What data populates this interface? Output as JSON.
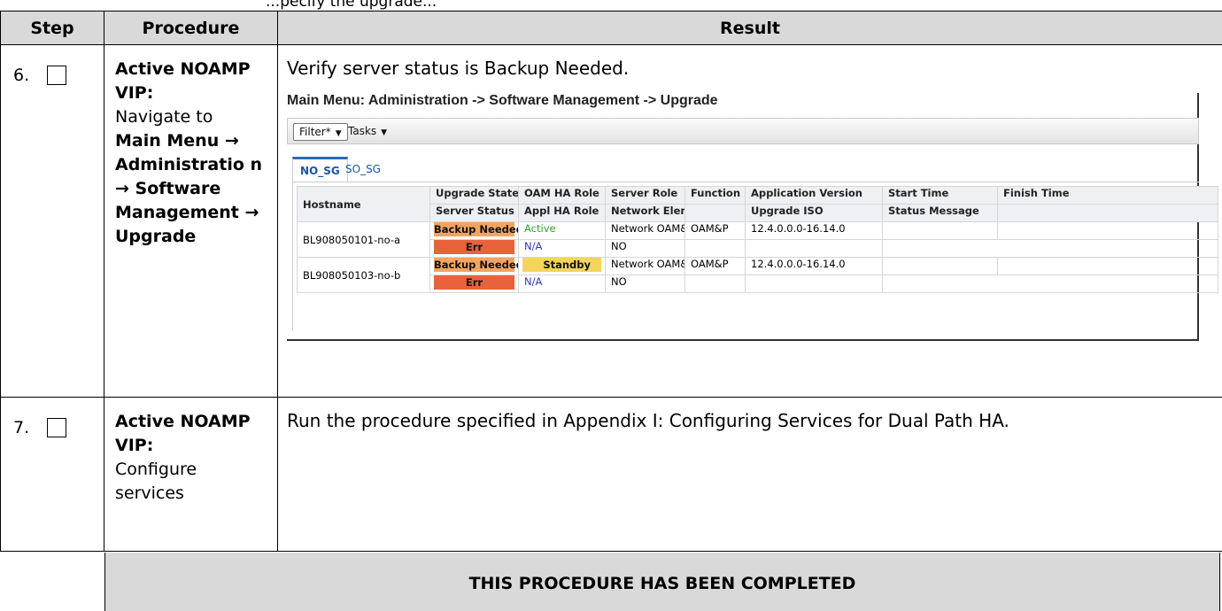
{
  "clipped_header": "...pecify the upgrade...",
  "headers": {
    "step": "Step",
    "procedure": "Procedure",
    "result": "Result"
  },
  "rows": [
    {
      "step": "6.",
      "proc_bold1": "Active NOAMP VIP:",
      "proc_plain": "Navigate to",
      "proc_bold2": "Main Menu → Administratio n → Software Management → Upgrade",
      "result_text": "Verify server status is Backup Needed."
    },
    {
      "step": "7.",
      "proc_bold1": "Active NOAMP VIP:",
      "proc_plain": "Configure services",
      "result_text": "Run the procedure specified in Appendix I: Configuring Services for Dual Path HA."
    }
  ],
  "gui": {
    "title": "Main Menu: Administration -> Software Management -> Upgrade",
    "filter_label": "Filter*",
    "tasks_label": "Tasks",
    "tabs": [
      "NO_SG",
      "SO_SG"
    ],
    "header_row1": [
      "Hostname",
      "Upgrade State",
      "OAM HA Role",
      "Server Role",
      "Function",
      "Application Version",
      "Start Time",
      "Finish Time"
    ],
    "header_row2": [
      "Server Status",
      "Appl HA Role",
      "Network Element",
      "",
      "Upgrade ISO",
      "Status Message"
    ],
    "servers": [
      {
        "hostname": "BL908050101-no-a",
        "upgrade_state": "Backup Needed",
        "oam_ha_role": "Active",
        "server_role": "Network OAM&P",
        "function": "OAM&P",
        "app_version": "12.4.0.0.0-16.14.0",
        "server_status": "Err",
        "appl_ha_role": "N/A",
        "network_element": "NO"
      },
      {
        "hostname": "BL908050103-no-b",
        "upgrade_state": "Backup Needed",
        "oam_ha_role": "Standby",
        "server_role": "Network OAM&P",
        "function": "OAM&P",
        "app_version": "12.4.0.0.0-16.14.0",
        "server_status": "Err",
        "appl_ha_role": "N/A",
        "network_element": "NO"
      }
    ]
  },
  "footer": "THIS PROCEDURE HAS BEEN COMPLETED"
}
